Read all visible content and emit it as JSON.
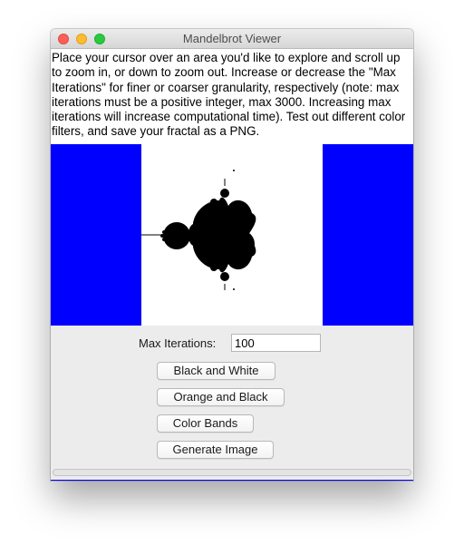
{
  "window": {
    "title": "Mandelbrot Viewer"
  },
  "instructions": {
    "text": "Place your cursor over an area you'd like to explore and scroll up to zoom in, or down to zoom out. Increase or decrease the \"Max Iterations\" for finer or coarser granularity, respectively (note: max iterations must be a positive integer, max 3000. Increasing max iterations will increase computational time). Test out different color filters, and save your fractal as a PNG."
  },
  "canvas": {
    "background_color": "#0000ff",
    "plot_bg_color": "#ffffff",
    "set_color": "#000000"
  },
  "controls": {
    "max_iterations_label": "Max Iterations:",
    "max_iterations_value": "100",
    "buttons": {
      "black_and_white": "Black and White",
      "orange_and_black": "Orange and Black",
      "color_bands": "Color Bands",
      "generate_image": "Generate Image"
    }
  }
}
